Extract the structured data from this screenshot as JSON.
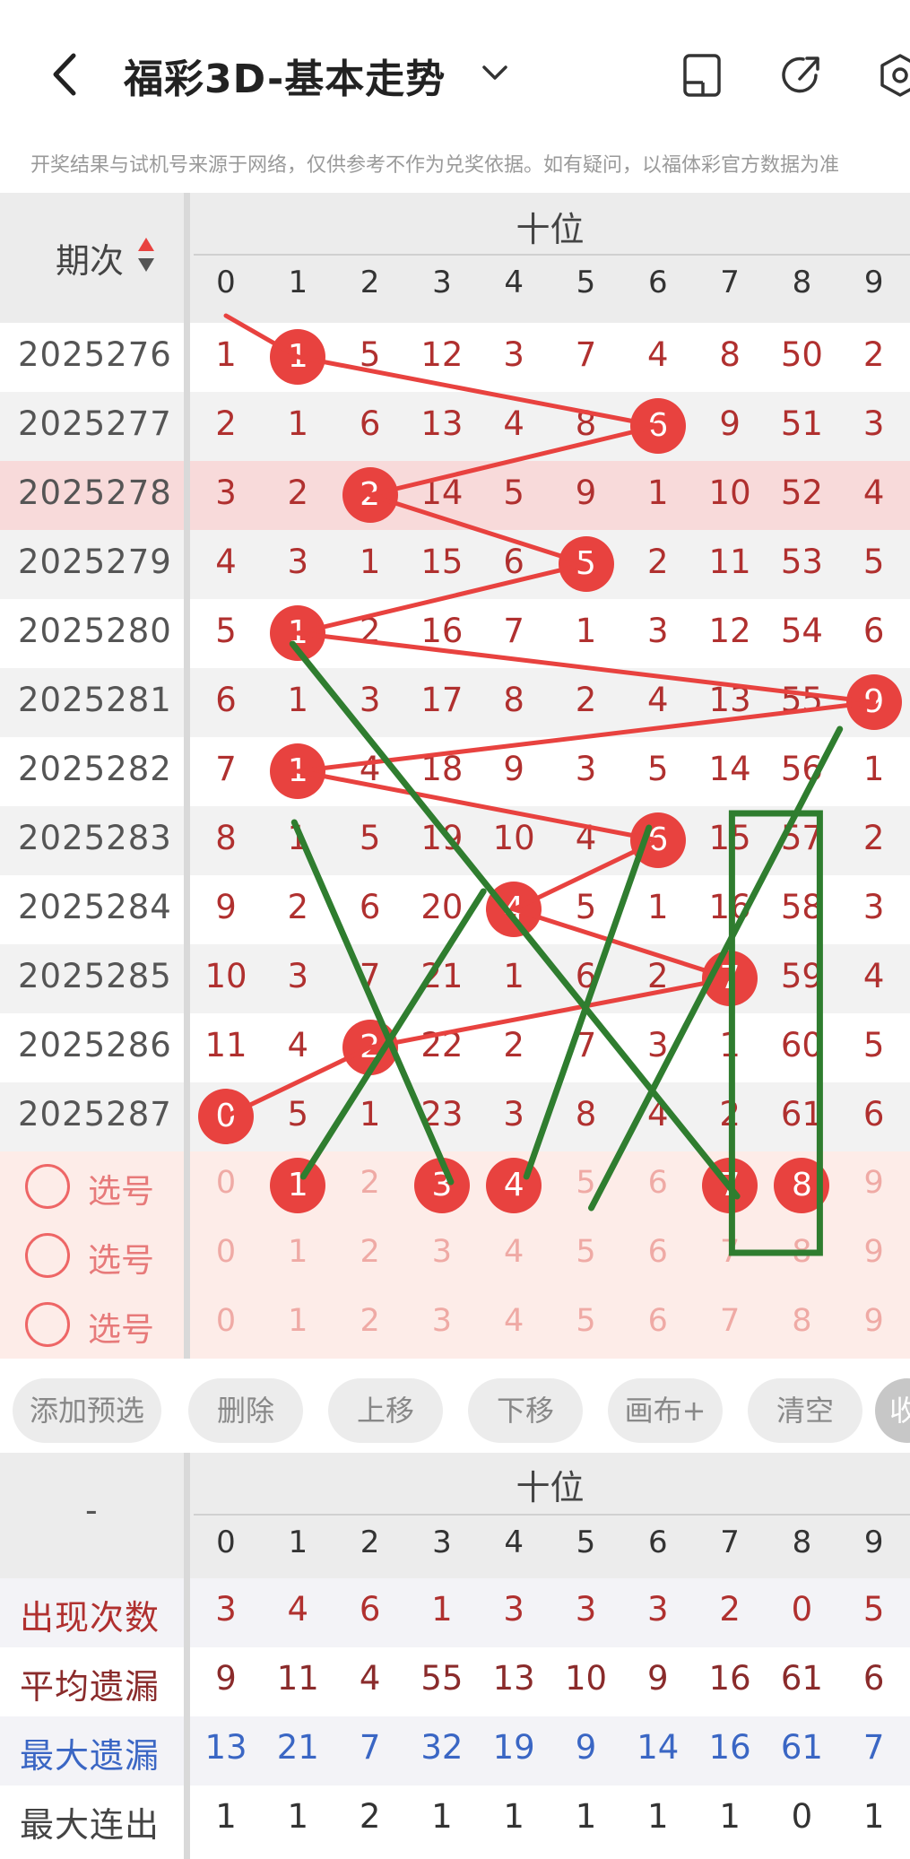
{
  "header": {
    "title": "福彩3D-基本走势",
    "notice": "开奖结果与试机号来源于网络，仅供参考不作为兑奖依据。如有疑问，以福体彩官方数据为准"
  },
  "grid": {
    "period_label": "期次",
    "position_label": "十位",
    "digits": [
      "0",
      "1",
      "2",
      "3",
      "4",
      "5",
      "6",
      "7",
      "8",
      "9"
    ],
    "rows": [
      {
        "period": "2025276",
        "cells": [
          "1",
          "1",
          "5",
          "12",
          "3",
          "7",
          "4",
          "8",
          "50",
          "2"
        ],
        "hit": 1
      },
      {
        "period": "2025277",
        "cells": [
          "2",
          "1",
          "6",
          "13",
          "4",
          "8",
          "6",
          "9",
          "51",
          "3"
        ],
        "hit": 6
      },
      {
        "period": "2025278",
        "cells": [
          "3",
          "2",
          "2",
          "14",
          "5",
          "9",
          "1",
          "10",
          "52",
          "4"
        ],
        "hit": 2
      },
      {
        "period": "2025279",
        "cells": [
          "4",
          "3",
          "1",
          "15",
          "6",
          "5",
          "2",
          "11",
          "53",
          "5"
        ],
        "hit": 5
      },
      {
        "period": "2025280",
        "cells": [
          "5",
          "1",
          "2",
          "16",
          "7",
          "1",
          "3",
          "12",
          "54",
          "6"
        ],
        "hit": 1
      },
      {
        "period": "2025281",
        "cells": [
          "6",
          "1",
          "3",
          "17",
          "8",
          "2",
          "4",
          "13",
          "55",
          "9"
        ],
        "hit": 9
      },
      {
        "period": "2025282",
        "cells": [
          "7",
          "1",
          "4",
          "18",
          "9",
          "3",
          "5",
          "14",
          "56",
          "1"
        ],
        "hit": 1
      },
      {
        "period": "2025283",
        "cells": [
          "8",
          "1",
          "5",
          "19",
          "10",
          "4",
          "6",
          "15",
          "57",
          "2"
        ],
        "hit": 6
      },
      {
        "period": "2025284",
        "cells": [
          "9",
          "2",
          "6",
          "20",
          "4",
          "5",
          "1",
          "16",
          "58",
          "3"
        ],
        "hit": 4
      },
      {
        "period": "2025285",
        "cells": [
          "10",
          "3",
          "7",
          "21",
          "1",
          "6",
          "2",
          "7",
          "59",
          "4"
        ],
        "hit": 7
      },
      {
        "period": "2025286",
        "cells": [
          "11",
          "4",
          "2",
          "22",
          "2",
          "7",
          "3",
          "1",
          "60",
          "5"
        ],
        "hit": 2
      },
      {
        "period": "2025287",
        "cells": [
          "0",
          "5",
          "1",
          "23",
          "3",
          "8",
          "4",
          "2",
          "61",
          "6"
        ],
        "hit": 0
      }
    ],
    "highlight_row": 2,
    "pick_label": "选号",
    "pick_rows": [
      {
        "selected": [
          1,
          3,
          4,
          7,
          8
        ]
      },
      {
        "selected": []
      },
      {
        "selected": []
      }
    ]
  },
  "toolbar": {
    "buttons": [
      "添加预选",
      "删除",
      "上移",
      "下移",
      "画布+",
      "清空"
    ],
    "collapse": "收"
  },
  "stats": {
    "dash": "-",
    "position_label": "十位",
    "digits": [
      "0",
      "1",
      "2",
      "3",
      "4",
      "5",
      "6",
      "7",
      "8",
      "9"
    ],
    "rows": [
      {
        "name": "出现次数",
        "values": [
          "3",
          "4",
          "6",
          "1",
          "3",
          "3",
          "3",
          "2",
          "0",
          "5"
        ],
        "name_color": "#b0302f",
        "value_color": "#b0302f"
      },
      {
        "name": "平均遗漏",
        "values": [
          "9",
          "11",
          "4",
          "55",
          "13",
          "10",
          "9",
          "16",
          "61",
          "6"
        ],
        "name_color": "#8a2b2b",
        "value_color": "#8a2b2b"
      },
      {
        "name": "最大遗漏",
        "values": [
          "13",
          "21",
          "7",
          "32",
          "19",
          "9",
          "14",
          "16",
          "61",
          "7"
        ],
        "name_color": "#3a66c4",
        "value_color": "#3a66c4"
      },
      {
        "name": "最大连出",
        "values": [
          "1",
          "1",
          "2",
          "1",
          "1",
          "1",
          "1",
          "1",
          "0",
          "1"
        ],
        "name_color": "#444444",
        "value_color": "#333333"
      }
    ]
  },
  "colors": {
    "accent": "#e8423f",
    "highlight_row": "#f8dada",
    "pick_bg": "#fdece8",
    "green_line": "#2f7d2f"
  }
}
